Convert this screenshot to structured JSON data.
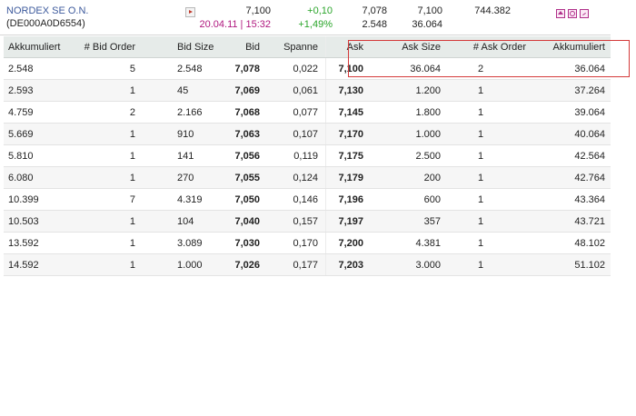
{
  "quote": {
    "name": "NORDEX SE O.N.",
    "isin": "(DE000A0D6554)",
    "last": "7,100",
    "datetime": "20.04.11 | 15:32",
    "change_abs": "+0,10",
    "change_pct": "+1,49%",
    "bid": "7,078",
    "bid_size": "2.548",
    "ask": "7,100",
    "ask_size": "36.064",
    "volume": "744.382",
    "icons": [
      "home-icon",
      "clock-icon",
      "chart-icon"
    ],
    "colors": {
      "name": "#3d5a9c",
      "date": "#b0187f",
      "positive": "#2aa52a",
      "highlight": "#d43a3a"
    }
  },
  "book": {
    "headers": [
      "Akkumuliert",
      "# Bid Order",
      "Bid Size",
      "Bid",
      "Spanne",
      "Ask",
      "Ask Size",
      "# Ask Order",
      "Akkumuliert"
    ],
    "rows": [
      [
        "2.548",
        "5",
        "2.548",
        "7,078",
        "0,022",
        "7,100",
        "36.064",
        "2",
        "36.064"
      ],
      [
        "2.593",
        "1",
        "45",
        "7,069",
        "0,061",
        "7,130",
        "1.200",
        "1",
        "37.264"
      ],
      [
        "4.759",
        "2",
        "2.166",
        "7,068",
        "0,077",
        "7,145",
        "1.800",
        "1",
        "39.064"
      ],
      [
        "5.669",
        "1",
        "910",
        "7,063",
        "0,107",
        "7,170",
        "1.000",
        "1",
        "40.064"
      ],
      [
        "5.810",
        "1",
        "141",
        "7,056",
        "0,119",
        "7,175",
        "2.500",
        "1",
        "42.564"
      ],
      [
        "6.080",
        "1",
        "270",
        "7,055",
        "0,124",
        "7,179",
        "200",
        "1",
        "42.764"
      ],
      [
        "10.399",
        "7",
        "4.319",
        "7,050",
        "0,146",
        "7,196",
        "600",
        "1",
        "43.364"
      ],
      [
        "10.503",
        "1",
        "104",
        "7,040",
        "0,157",
        "7,197",
        "357",
        "1",
        "43.721"
      ],
      [
        "13.592",
        "1",
        "3.089",
        "7,030",
        "0,170",
        "7,200",
        "4.381",
        "1",
        "48.102"
      ],
      [
        "14.592",
        "1",
        "1.000",
        "7,026",
        "0,177",
        "7,203",
        "3.000",
        "1",
        "51.102"
      ]
    ]
  }
}
